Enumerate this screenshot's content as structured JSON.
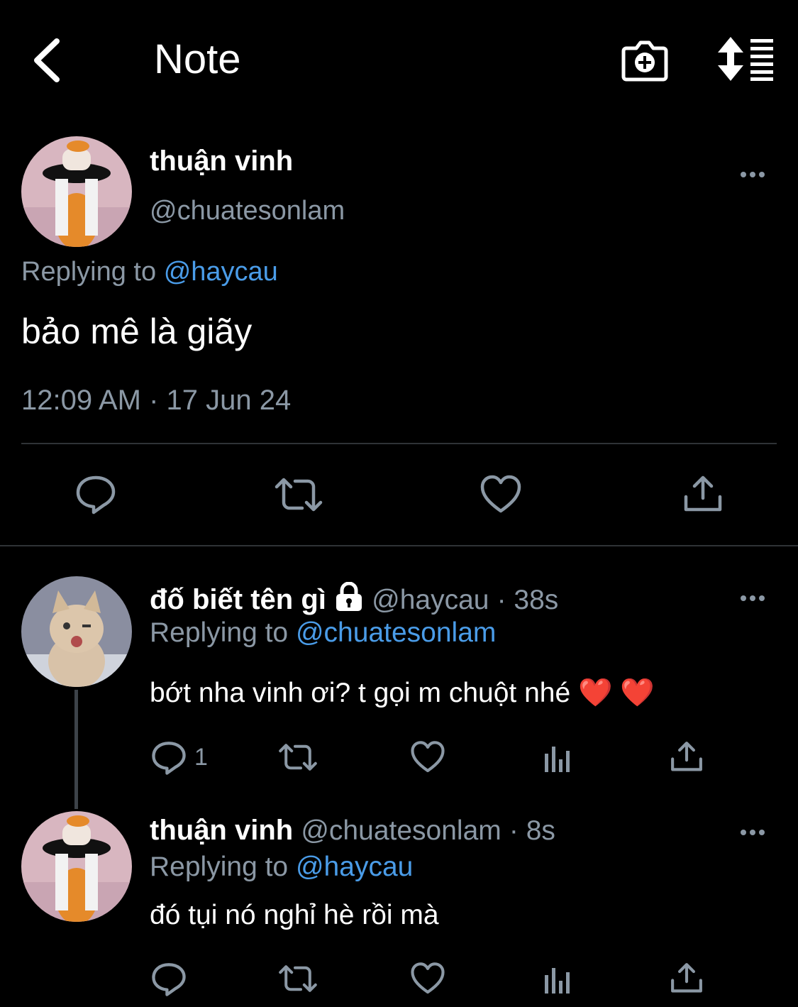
{
  "header": {
    "title": "Note"
  },
  "main_tweet": {
    "display_name": "thuận vinh",
    "handle": "@chuatesonlam",
    "replying_prefix": "Replying to",
    "replying_to": "@haycau",
    "text": "bảo mê là giãy",
    "timestamp": "12:09 AM · 17 Jun 24"
  },
  "replies": [
    {
      "display_name": "đố biết tên gì",
      "locked": true,
      "handle": "@haycau",
      "time": "· 38s",
      "replying_prefix": "Replying to",
      "replying_to": "@chuatesonlam",
      "text": "bớt nha vinh ơi? t gọi m chuột nhé ❤️ ❤️",
      "reply_count": "1"
    },
    {
      "display_name": "thuận vinh",
      "handle": "@chuatesonlam",
      "time": "· 8s",
      "replying_prefix": "Replying to",
      "replying_to": "@haycau",
      "text": "đó tụi nó nghỉ hè rồi mà"
    }
  ],
  "colors": {
    "background": "#000000",
    "text": "#ffffff",
    "muted": "#8b98a5",
    "link": "#4a9ce8",
    "divider": "#2f3336"
  }
}
